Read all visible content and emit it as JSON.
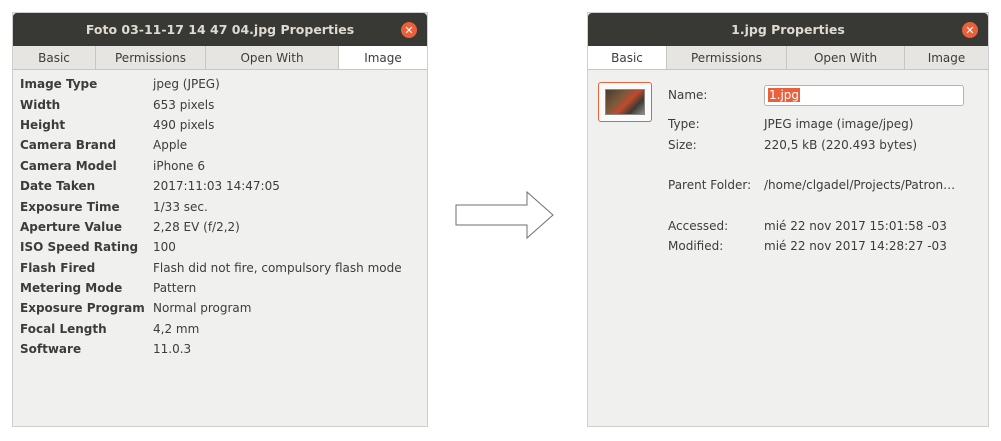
{
  "left_window": {
    "title": "Foto 03-11-17 14 47 04.jpg Properties",
    "close_glyph": "✕",
    "tabs": [
      {
        "label": "Basic",
        "active": false
      },
      {
        "label": "Permissions",
        "active": false
      },
      {
        "label": "Open With",
        "active": false
      },
      {
        "label": "Image",
        "active": true
      }
    ],
    "properties": [
      {
        "key": "Image Type",
        "value": "jpeg (JPEG)"
      },
      {
        "key": "Width",
        "value": "653 pixels"
      },
      {
        "key": "Height",
        "value": "490 pixels"
      },
      {
        "key": "Camera Brand",
        "value": "Apple"
      },
      {
        "key": "Camera Model",
        "value": "iPhone 6"
      },
      {
        "key": "Date Taken",
        "value": "2017:11:03 14:47:05"
      },
      {
        "key": "Exposure Time",
        "value": "1/33 sec."
      },
      {
        "key": "Aperture Value",
        "value": "2,28 EV (f/2,2)"
      },
      {
        "key": "ISO Speed Rating",
        "value": "100"
      },
      {
        "key": "Flash Fired",
        "value": "Flash did not fire, compulsory flash mode"
      },
      {
        "key": "Metering Mode",
        "value": "Pattern"
      },
      {
        "key": "Exposure Program",
        "value": "Normal program"
      },
      {
        "key": "Focal Length",
        "value": "4,2 mm"
      },
      {
        "key": "Software",
        "value": "11.0.3"
      }
    ]
  },
  "right_window": {
    "title": "1.jpg Properties",
    "close_glyph": "✕",
    "tabs": [
      {
        "label": "Basic",
        "active": true
      },
      {
        "label": "Permissions",
        "active": false
      },
      {
        "label": "Open With",
        "active": false
      },
      {
        "label": "Image",
        "active": false
      }
    ],
    "basic": {
      "name_label": "Name:",
      "name_value": "1.jpg",
      "type_label": "Type:",
      "type_value": "JPEG image (image/jpeg)",
      "size_label": "Size:",
      "size_value": "220,5 kB (220.493 bytes)",
      "parent_label": "Parent Folder:",
      "parent_value": "/home/clgadel/Projects/Patron…",
      "accessed_label": "Accessed:",
      "accessed_value": "mié 22 nov 2017 15:01:58 -03",
      "modified_label": "Modified:",
      "modified_value": "mié 22 nov 2017 14:28:27 -03"
    }
  },
  "colors": {
    "titlebar": "#383835",
    "accent": "#e9603a",
    "window_bg": "#f0f0ef"
  },
  "arrow_icon": "right-arrow-icon"
}
